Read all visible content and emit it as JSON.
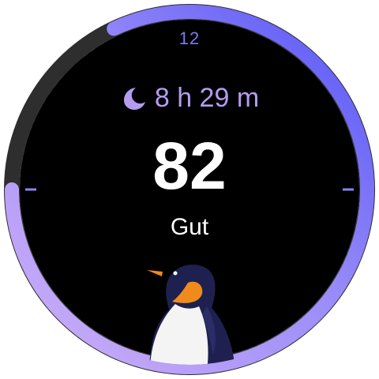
{
  "watch_face": {
    "top_tick_label": "12",
    "sleep": {
      "icon": "moon-icon",
      "duration": "8 h 29 m"
    },
    "score": {
      "value": "82",
      "rating": "Gut",
      "progress_fraction": 0.82
    },
    "mascot": "penguin-illustration"
  },
  "colors": {
    "background": "#000000",
    "ring_track": "#2e2e2e",
    "ring_start": "#c8a8f8",
    "ring_end": "#5c5cf8",
    "accent_text": "#b49cf0",
    "tick_label": "#7b7bf0"
  }
}
